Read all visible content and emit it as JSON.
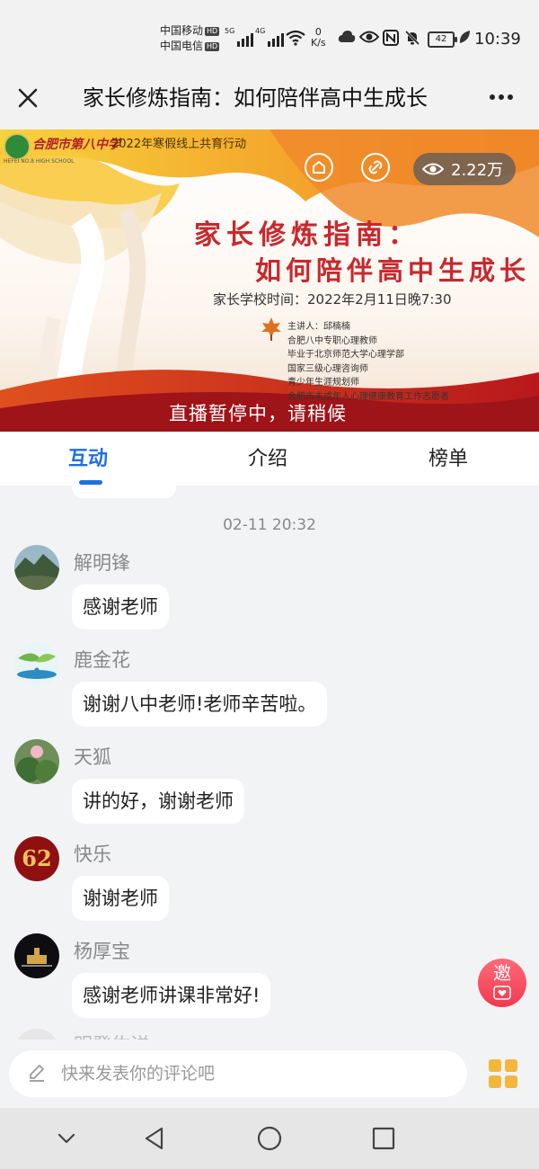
{
  "status_bar": {
    "carrier_1": "中国移动",
    "carrier_2": "中国电信",
    "hd": "HD",
    "net_1": "5G",
    "net_2": "4G",
    "speed_value": "0",
    "speed_unit": "K/s",
    "battery": "42",
    "time": "10:39"
  },
  "header": {
    "title": "家长修炼指南：如何陪伴高中生成长"
  },
  "banner": {
    "school_name": "合肥市第八中学",
    "school_name_en": "HEFEI NO.8 HIGH SCHOOL",
    "campaign": "2022年寒假线上共育行动",
    "views": "2.22万",
    "title_line_1": "家长修炼指南：",
    "title_line_2": "如何陪伴高中生成长",
    "school_time": "家长学校时间：2022年2月11日晚7:30",
    "speaker_lines": [
      "主讲人：邱楠楠",
      "合肥八中专职心理教师",
      "毕业于北京师范大学心理学部",
      "国家三级心理咨询师",
      "青少年生涯规划师",
      "合肥市未成年人心理健康教育工作志愿者"
    ],
    "live_status": "直播暂停中，请稍候"
  },
  "tabs": [
    {
      "label": "互动",
      "active": true
    },
    {
      "label": "介绍",
      "active": false
    },
    {
      "label": "榜单",
      "active": false
    }
  ],
  "chat": {
    "timestamp": "02-11 20:32",
    "messages": [
      {
        "name": "解明锋",
        "text": "感谢老师"
      },
      {
        "name": "鹿金花",
        "text": "谢谢八中老师!老师辛苦啦。"
      },
      {
        "name": "天狐",
        "text": "讲的好，谢谢老师"
      },
      {
        "name": "快乐",
        "text": "谢谢老师",
        "avatar_text": "62"
      },
      {
        "name": "杨厚宝",
        "text": "感谢老师讲课非常好!"
      }
    ],
    "partial_name": "明登佐详"
  },
  "invite": {
    "label": "邀"
  },
  "comment": {
    "placeholder": "快来发表你的评论吧"
  },
  "colors": {
    "accent": "#1f6fe5",
    "banner_title": "#c8282d",
    "invite": "#f2394f",
    "grid_icon": "#f4b73a"
  }
}
